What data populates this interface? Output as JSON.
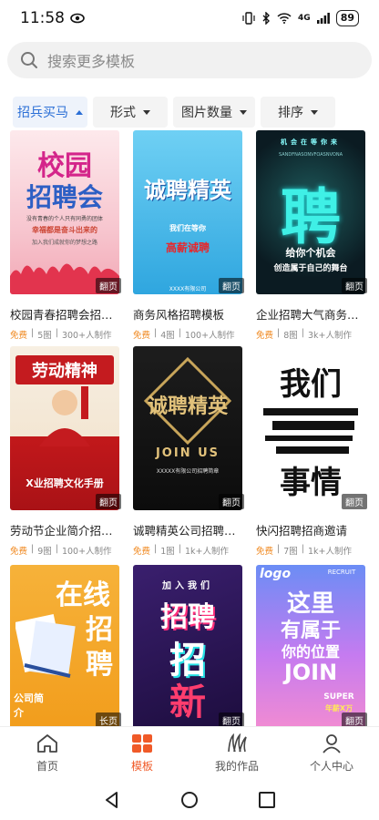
{
  "status": {
    "time": "11:58",
    "battery": "89",
    "network": "4G"
  },
  "search": {
    "placeholder": "搜索更多模板"
  },
  "filters": [
    {
      "label": "招兵买马",
      "active": true
    },
    {
      "label": "形式",
      "active": false
    },
    {
      "label": "图片数量",
      "active": false
    },
    {
      "label": "排序",
      "active": false
    }
  ],
  "cards": [
    {
      "title": "校园青春招聘会招聘…",
      "free": "免费",
      "pages": "5图",
      "users": "300+人制作",
      "badge": "翻页",
      "art_lines": [
        "校园",
        "招聘会",
        "没有青春的个人只有同勇的团体",
        "幸福都是奋斗出来的",
        "加入我们成就你的梦想之路"
      ]
    },
    {
      "title": "商务风格招聘模板",
      "free": "免费",
      "pages": "4图",
      "users": "100+人制作",
      "badge": "翻页",
      "art_lines": [
        "诚聘精英",
        "我们在等你",
        "高薪诚聘",
        "XXXX有限公司"
      ]
    },
    {
      "title": "企业招聘大气商务风…",
      "free": "免费",
      "pages": "8图",
      "users": "3k+人制作",
      "badge": "翻页",
      "art_lines": [
        "机会在等你来",
        "SANDFNASONVFOASNVONA",
        "聘",
        "给你个机会",
        "创造属于自己的舞台"
      ]
    },
    {
      "title": "劳动节企业简介招聘…",
      "free": "免费",
      "pages": "9图",
      "users": "100+人制作",
      "badge": "翻页",
      "art_lines": [
        "劳动精神",
        "X业招聘文化手册"
      ]
    },
    {
      "title": "诚聘精英公司招聘校…",
      "free": "免费",
      "pages": "1图",
      "users": "1k+人制作",
      "badge": "翻页",
      "art_lines": [
        "诚聘精英",
        "JOIN US",
        "XXXXX有限公司招聘简章"
      ]
    },
    {
      "title": "快闪招聘招商邀请",
      "free": "免费",
      "pages": "7图",
      "users": "1k+人制作",
      "badge": "翻页",
      "art_lines": [
        "我们",
        "事情"
      ]
    },
    {
      "title": "",
      "free": "",
      "pages": "",
      "users": "",
      "badge": "长页",
      "art_lines": [
        "在线",
        "招",
        "聘",
        "公司简介"
      ]
    },
    {
      "title": "",
      "free": "",
      "pages": "",
      "users": "",
      "badge": "翻页",
      "art_lines": [
        "加入我们",
        "招聘",
        "招",
        "新"
      ]
    },
    {
      "title": "",
      "free": "",
      "pages": "",
      "users": "",
      "badge": "翻页",
      "art_lines": [
        "logo",
        "RECRUIT",
        "这里",
        "有属于",
        "你的位置",
        "JOIN",
        "SUPER",
        "年薪X万"
      ]
    }
  ],
  "nav": [
    {
      "label": "首页",
      "active": false
    },
    {
      "label": "模板",
      "active": true
    },
    {
      "label": "我的作品",
      "active": false
    },
    {
      "label": "个人中心",
      "active": false
    }
  ],
  "colors": {
    "accent": "#f05a28",
    "filter_active": "#2b6fd6",
    "free": "#f08a22"
  }
}
